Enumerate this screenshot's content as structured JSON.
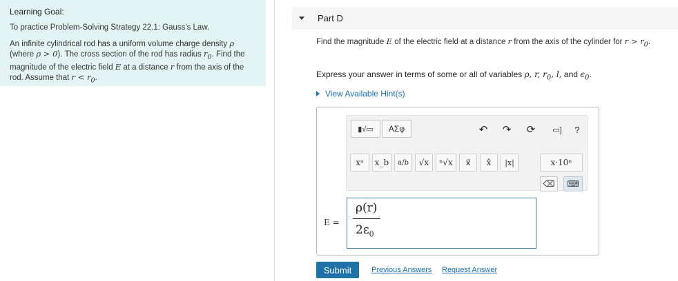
{
  "goal": {
    "title": "Learning Goal:",
    "subtitle": "To practice Problem-Solving Strategy 22.1: Gauss's Law.",
    "line1a": "An infinite cylindrical rod has a uniform volume charge density ",
    "rho": "ρ",
    "line2a": "(where ",
    "rho_cond": "ρ > 0",
    "line2b": "). The cross section of the rod has radius ",
    "r0": "r",
    "r0_sub": "0",
    "line2c": ". Find the",
    "line3a": "magnitude of the electric field ",
    "E": "E",
    "line3b": " at a distance ",
    "r": "r",
    "line3c": " from the axis of the",
    "line4a": "rod. Assume that ",
    "cond": "r < r",
    "cond_sub": "0",
    "line4b": "."
  },
  "part": {
    "label": "Part D"
  },
  "question": {
    "a": "Find the magnitude ",
    "E": "E",
    "b": " of the electric field at a distance ",
    "r": "r",
    "c": " from the axis of the cylinder for ",
    "cond": "r > r",
    "cond_sub": "0",
    "d": "."
  },
  "instruction": {
    "text": "Express your answer in terms of some or all of variables ",
    "vars": "ρ, r, r",
    "vars_sub": "0",
    "vars2": ", l,",
    "and": " and ",
    "eps": "ϵ",
    "eps_sub": "0",
    "end": "."
  },
  "hint": {
    "label": "View Available Hint(s)"
  },
  "toolbar": {
    "template_label": "▮√▭",
    "greek_label": "ΑΣφ",
    "undo": "↶",
    "redo": "↷",
    "reset": "⟳",
    "keyboard": "▭]",
    "help": "?",
    "symbols": [
      "xᵃ",
      "x_b",
      "a/b",
      "√x",
      "ⁿ√x",
      "x⃗",
      "x̂",
      "|x|",
      "x·10ⁿ"
    ],
    "backspace": "⌫",
    "keypad": "⌨"
  },
  "answer": {
    "label": "E =",
    "numerator": "ρ(r)",
    "denominator": "2ε",
    "denominator_sub": "0"
  },
  "buttons": {
    "submit": "Submit",
    "previous": "Previous Answers",
    "request": "Request Answer"
  }
}
